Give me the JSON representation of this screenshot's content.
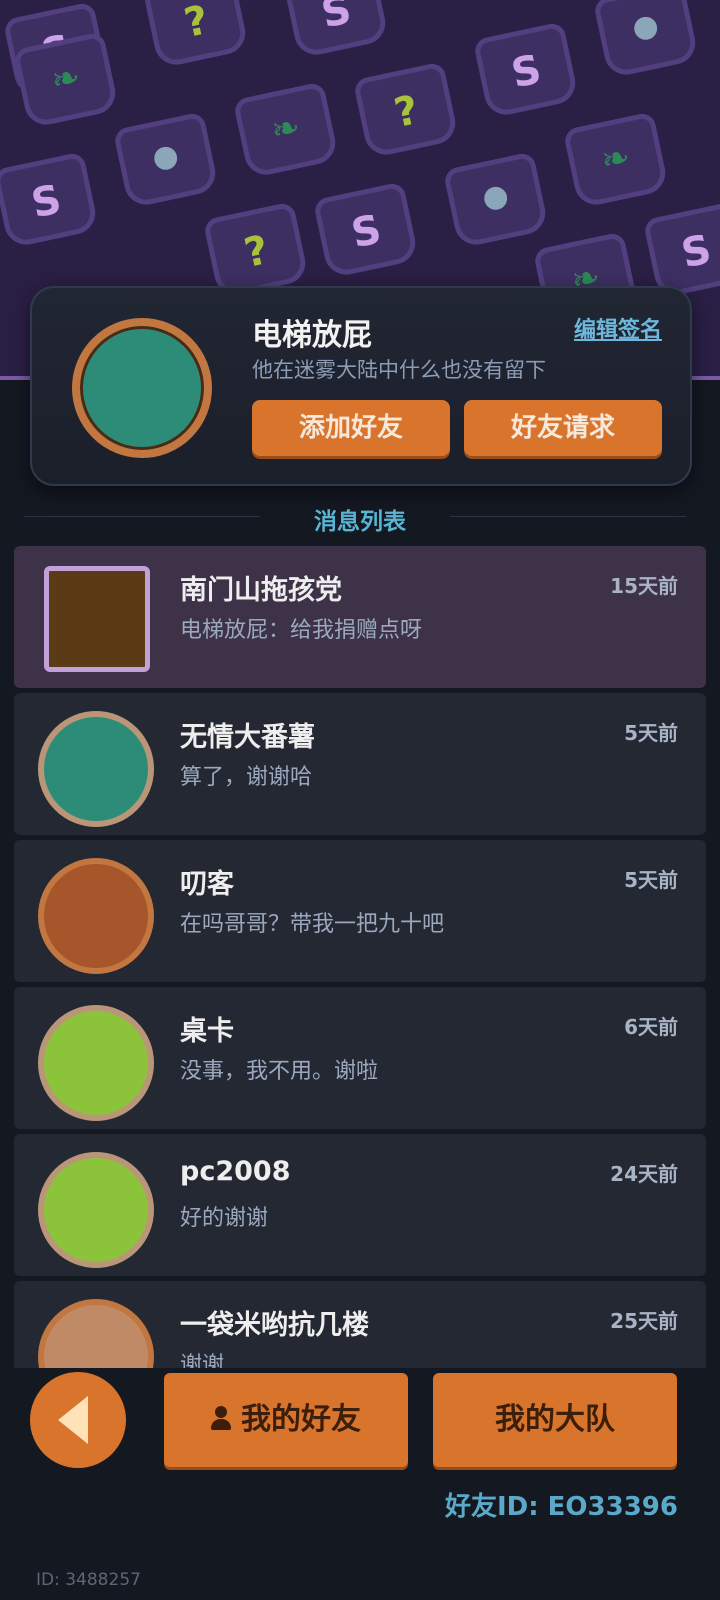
{
  "profile": {
    "name": "电梯放屁",
    "signature": "他在迷雾大陆中什么也没有留下",
    "edit_label": "编辑签名",
    "add_friend_label": "添加好友",
    "friend_request_label": "好友请求"
  },
  "section": {
    "title": "消息列表"
  },
  "messages": [
    {
      "name": "南门山拖孩党",
      "text": "电梯放屁：给我捐赠点呀",
      "time": "15天前"
    },
    {
      "name": "无情大番薯",
      "text": "算了，谢谢哈",
      "time": "5天前"
    },
    {
      "name": "叨客",
      "text": "在吗哥哥？带我一把九十吧",
      "time": "5天前"
    },
    {
      "name": "桌卡",
      "text": "没事，我不用。谢啦",
      "time": "6天前"
    },
    {
      "name": "pc2008",
      "text": "好的谢谢",
      "time": "24天前"
    },
    {
      "name": "一袋米哟抗几楼",
      "text": "谢谢",
      "time": "25天前"
    }
  ],
  "bottom": {
    "my_friends_label": "我的好友",
    "my_team_label": "我的大队",
    "friend_id": "好友ID: EO33396",
    "user_id": "ID: 3488257"
  },
  "colors": {
    "accent_orange": "#d9742c",
    "link_blue": "#6db7dc",
    "selected_row": "#3d3247",
    "banner_purple": "#2a1f44"
  },
  "icons": {
    "back": "back-arrow-icon",
    "person": "person-icon"
  }
}
